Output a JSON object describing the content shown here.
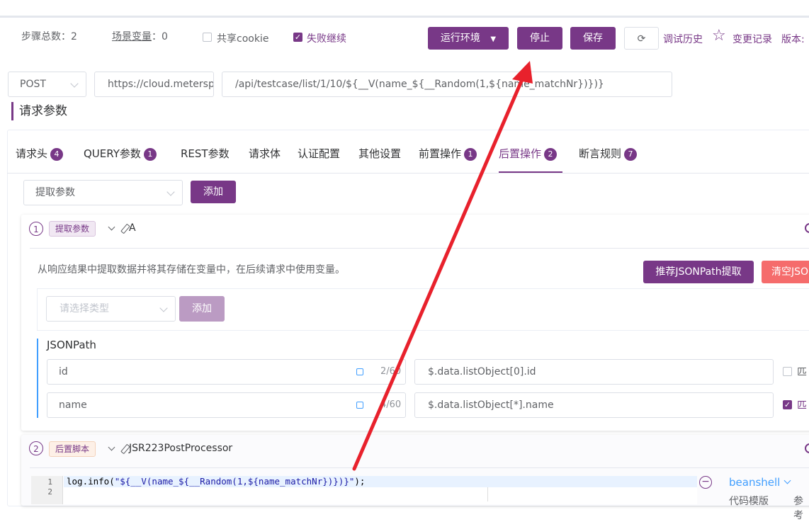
{
  "colors": {
    "primary": "#783887",
    "danger": "#f56c6c",
    "link": "#409eff",
    "arrow": "#e8212c"
  },
  "toolbar": {
    "steps_label": "步骤总数：",
    "steps_value": "2",
    "scene_vars_label": "场景变量",
    "scene_vars_sep": "：",
    "scene_vars_value": "0",
    "share_cookie_label": "共享cookie",
    "share_cookie_checked": false,
    "continue_on_fail_label": "失败继续",
    "continue_on_fail_checked": true,
    "env_button": "运行环境",
    "stop_button": "停止",
    "save_button": "保存",
    "refresh_icon": "refresh-icon",
    "debug_history": "调试历史",
    "star_icon": "star-icon",
    "change_log": "变更记录",
    "version": "版本:"
  },
  "request": {
    "method": "POST",
    "base_url": "https://cloud.metersp",
    "path": "/api/testcase/list/1/10/${__V(name_${__Random(1,${name_matchNr})})}"
  },
  "section_title": "请求参数",
  "tabs": [
    {
      "label": "请求头",
      "badge": "4"
    },
    {
      "label": "QUERY参数",
      "badge": "1"
    },
    {
      "label": "REST参数",
      "badge": ""
    },
    {
      "label": "请求体",
      "badge": ""
    },
    {
      "label": "认证配置",
      "badge": ""
    },
    {
      "label": "其他设置",
      "badge": ""
    },
    {
      "label": "前置操作",
      "badge": "1"
    },
    {
      "label": "后置操作",
      "badge": "2",
      "active": true
    },
    {
      "label": "断言规则",
      "badge": "7"
    }
  ],
  "post_ops": {
    "select_value": "提取参数",
    "add_button": "添加"
  },
  "step1": {
    "num": "1",
    "tag": "提取参数",
    "name": "A",
    "description": "从响应结果中提取数据并将其存储在变量中，在后续请求中使用变量。",
    "recommend_button": "推荐JSONPath提取",
    "clear_button": "清空JSO",
    "type_placeholder": "请选择类型",
    "type_add_button": "添加",
    "jsonpath_label": "JSONPath",
    "rows": [
      {
        "name": "id",
        "count": "2/60",
        "expr": "$.data.listObject[0].id",
        "checked": false,
        "match": "匹"
      },
      {
        "name": "name",
        "count": "4/60",
        "expr": "$.data.listObject[*].name",
        "checked": true,
        "match": "匹"
      }
    ]
  },
  "step2": {
    "num": "2",
    "tag": "后置脚本",
    "name": "JSR223PostProcessor",
    "code_line1_pre": "log.info(",
    "code_line1_str": "\"${__V(name_${__Random(1,${name_matchNr})})}\"",
    "code_line1_post": ");",
    "line_numbers": [
      "1",
      "2"
    ],
    "language": "beanshell",
    "code_template": "代码模版",
    "ref_link": "参考"
  }
}
